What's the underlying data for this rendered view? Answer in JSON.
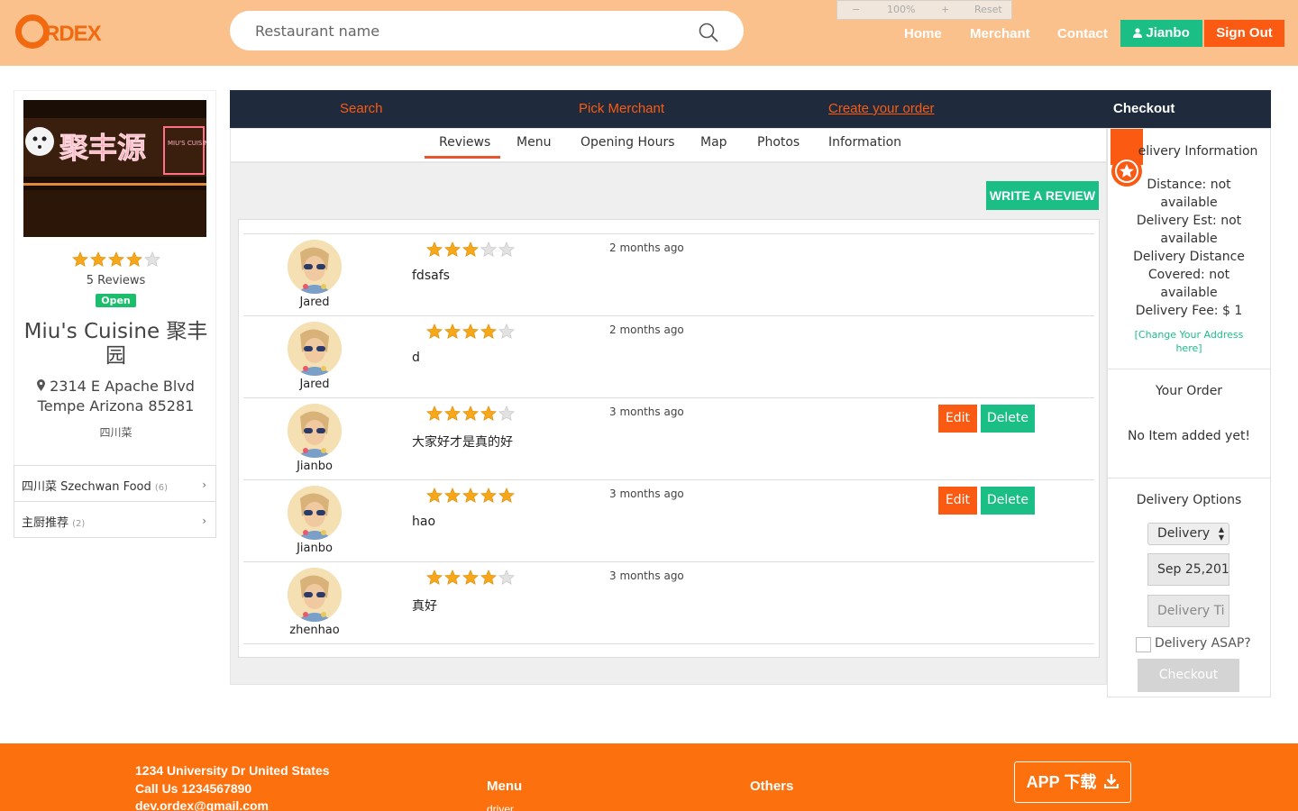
{
  "header": {
    "logo_text": "RDEX",
    "search_placeholder": "Restaurant name",
    "zoom": {
      "minus": "−",
      "level": "100%",
      "plus": "+",
      "reset": "Reset"
    },
    "nav": [
      "Home",
      "Merchant",
      "Contact"
    ],
    "user_label": "Jianbo",
    "signout_label": "Sign Out"
  },
  "restaurant": {
    "rating": 4,
    "reviews_count_label": "5 Reviews",
    "status": "Open",
    "name": "Miu's Cuisine 聚丰园",
    "address_line1": "2314 E Apache Blvd",
    "address_line2": "Tempe Arizona 85281",
    "cuisine": "四川菜",
    "sign_text": "聚丰源",
    "sign_text_en": "MIU'S CUISINE",
    "categories": [
      {
        "name": "四川菜 Szechwan Food",
        "count": "(6)"
      },
      {
        "name": "主厨推荐",
        "count": "(2)"
      }
    ]
  },
  "steps": [
    "Search",
    "Pick Merchant",
    "Create your order",
    "Checkout"
  ],
  "tabs": [
    "Reviews",
    "Menu",
    "Opening Hours",
    "Map",
    "Photos",
    "Information"
  ],
  "write_review_label": "WRITE A REVIEW",
  "reviews": [
    {
      "user": "Jared",
      "stars": 3,
      "time": "2 months ago",
      "text": "fdsafs",
      "editable": false
    },
    {
      "user": "Jared",
      "stars": 4,
      "time": "2 months ago",
      "text": "d",
      "editable": false
    },
    {
      "user": "Jianbo",
      "stars": 4,
      "time": "3 months ago",
      "text": "大家好才是真的好",
      "editable": true
    },
    {
      "user": "Jianbo",
      "stars": 5,
      "time": "3 months ago",
      "text": "hao",
      "editable": true
    },
    {
      "user": "zhenhao",
      "stars": 4,
      "time": "3 months ago",
      "text": "真好",
      "editable": false
    }
  ],
  "review_actions": {
    "edit": "Edit",
    "delete": "Delete"
  },
  "delivery": {
    "title": "elivery Information",
    "distance": "Distance: not available",
    "est": "Delivery Est: not available",
    "covered": "Delivery Distance Covered: not available",
    "fee": "Delivery Fee: $ 1",
    "change_address": "[Change Your Address here]"
  },
  "order": {
    "title": "Your Order",
    "empty": "No Item added yet!"
  },
  "delivery_options": {
    "title": "Delivery Options",
    "select_value": "Delivery",
    "date_value": "Sep 25,201",
    "time_placeholder": "Delivery Ti",
    "asap_label": "Delivery ASAP?",
    "checkout_label": "Checkout"
  },
  "footer": {
    "address": "1234 University Dr United States",
    "phone": "Call Us 1234567890",
    "email": "dev.ordex@gmail.com",
    "menu_title": "Menu",
    "menu_item": "driver",
    "others_title": "Others",
    "app_label": "APP 下载"
  },
  "colors": {
    "orange": "#fb5a12",
    "green": "#1bbf86",
    "header_bg": "#fbc18c",
    "steps_bg": "#1f2b3c",
    "star": "#f7a81a"
  }
}
